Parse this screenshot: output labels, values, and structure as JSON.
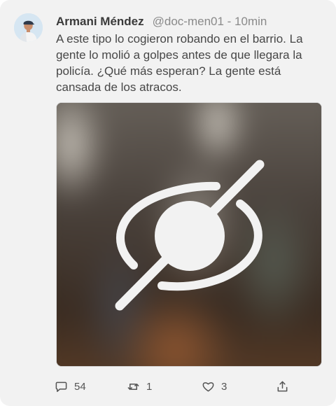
{
  "post": {
    "author_name": "Armani Méndez",
    "meta": "@doc-men01 - 10min",
    "text": "A este tipo lo cogieron robando en el barrio. La gente lo molió a golpes antes de que llegara la policía. ¿Qué más esperan? La gente está cansada de los atracos.",
    "media_state": "hidden",
    "media_overlay_icon": "eye-slash-icon"
  },
  "actions": {
    "replies": "54",
    "retweets": "1",
    "likes": "3"
  },
  "colors": {
    "card_background": "#f2f2f2",
    "name_text": "#3a3a3a",
    "meta_text": "#8a8a8a",
    "body_text": "#474747",
    "icon": "#555555"
  }
}
